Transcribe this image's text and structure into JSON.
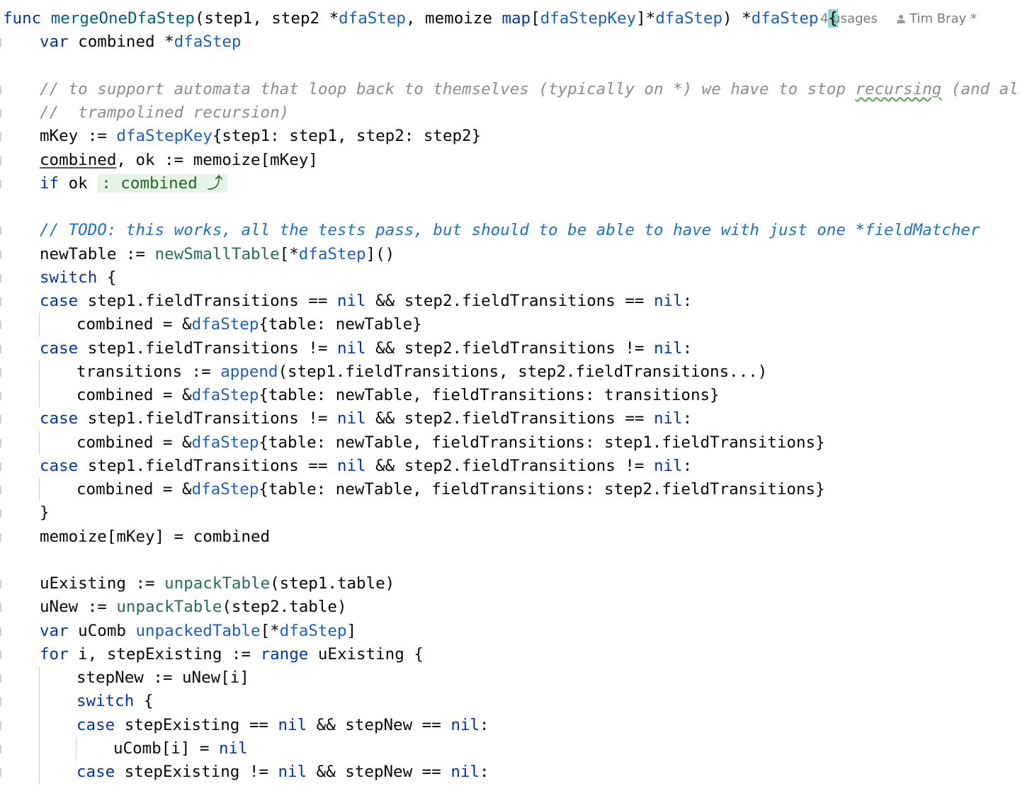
{
  "editor": {
    "inlay_usages": "4 usages",
    "inlay_author": "Tim Bray",
    "inlay_author_mark": "*",
    "lines": [
      {
        "indent": 0,
        "tokens": [
          {
            "t": "func ",
            "c": "kw"
          },
          {
            "t": "mergeOneDfaStep",
            "c": "func"
          },
          {
            "t": "(step1, step2 *",
            "c": "plain"
          },
          {
            "t": "dfaStep",
            "c": "type"
          },
          {
            "t": ", memoize ",
            "c": "plain"
          },
          {
            "t": "map",
            "c": "kw"
          },
          {
            "t": "[",
            "c": "plain"
          },
          {
            "t": "dfaStepKey",
            "c": "type"
          },
          {
            "t": "]*",
            "c": "plain"
          },
          {
            "t": "dfaStep",
            "c": "type"
          },
          {
            "t": ") *",
            "c": "plain"
          },
          {
            "t": "dfaStep",
            "c": "type"
          },
          {
            "t": " ",
            "c": "plain"
          },
          {
            "t": "{",
            "c": "brace-hl"
          }
        ]
      },
      {
        "indent": 1,
        "tokens": [
          {
            "t": "var",
            "c": "kw"
          },
          {
            "t": " combined *",
            "c": "plain"
          },
          {
            "t": "dfaStep",
            "c": "type"
          }
        ]
      },
      {
        "indent": 0,
        "tokens": []
      },
      {
        "indent": 1,
        "tokens": [
          {
            "t": "// to support automata that loop back to themselves (typically on *) we have to stop ",
            "c": "comment"
          },
          {
            "t": "recursing",
            "c": "comment-squiggle"
          },
          {
            "t": " (and also",
            "c": "comment"
          }
        ]
      },
      {
        "indent": 1,
        "tokens": [
          {
            "t": "//  trampolined recursion)",
            "c": "comment"
          }
        ]
      },
      {
        "indent": 1,
        "tokens": [
          {
            "t": "mKey := ",
            "c": "plain"
          },
          {
            "t": "dfaStepKey",
            "c": "type"
          },
          {
            "t": "{step1: step1, step2: step2}",
            "c": "plain"
          }
        ]
      },
      {
        "indent": 1,
        "tokens": [
          {
            "t": "combined",
            "c": "under"
          },
          {
            "t": ", ok := memoize[mKey]",
            "c": "plain"
          }
        ]
      },
      {
        "indent": 1,
        "tokens": [
          {
            "t": "if",
            "c": "kw"
          },
          {
            "t": " ok ",
            "c": "plain"
          },
          {
            "t": ": combined ⤴",
            "c": "hint"
          }
        ]
      },
      {
        "indent": 0,
        "tokens": []
      },
      {
        "indent": 1,
        "tokens": [
          {
            "t": "// TODO: this works, all the tests pass, but should to be able to have with just one *fieldMatcher",
            "c": "todo"
          }
        ]
      },
      {
        "indent": 1,
        "tokens": [
          {
            "t": "newTable := ",
            "c": "plain"
          },
          {
            "t": "newSmallTable",
            "c": "call"
          },
          {
            "t": "[*",
            "c": "plain"
          },
          {
            "t": "dfaStep",
            "c": "type"
          },
          {
            "t": "]()",
            "c": "plain"
          }
        ]
      },
      {
        "indent": 1,
        "tokens": [
          {
            "t": "switch",
            "c": "kw"
          },
          {
            "t": " {",
            "c": "plain"
          }
        ]
      },
      {
        "indent": 1,
        "tokens": [
          {
            "t": "case",
            "c": "kw"
          },
          {
            "t": " step1.fieldTransitions == ",
            "c": "plain"
          },
          {
            "t": "nil",
            "c": "kw"
          },
          {
            "t": " && step2.fieldTransitions == ",
            "c": "plain"
          },
          {
            "t": "nil",
            "c": "kw"
          },
          {
            "t": ":",
            "c": "plain"
          }
        ]
      },
      {
        "indent": 2,
        "tokens": [
          {
            "t": "combined = &",
            "c": "plain"
          },
          {
            "t": "dfaStep",
            "c": "type"
          },
          {
            "t": "{table: newTable}",
            "c": "plain"
          }
        ]
      },
      {
        "indent": 1,
        "tokens": [
          {
            "t": "case",
            "c": "kw"
          },
          {
            "t": " step1.fieldTransitions != ",
            "c": "plain"
          },
          {
            "t": "nil",
            "c": "kw"
          },
          {
            "t": " && step2.fieldTransitions != ",
            "c": "plain"
          },
          {
            "t": "nil",
            "c": "kw"
          },
          {
            "t": ":",
            "c": "plain"
          }
        ]
      },
      {
        "indent": 2,
        "tokens": [
          {
            "t": "transitions := ",
            "c": "plain"
          },
          {
            "t": "append",
            "c": "type"
          },
          {
            "t": "(step1.fieldTransitions, step2.fieldTransitions...)",
            "c": "plain"
          }
        ]
      },
      {
        "indent": 2,
        "tokens": [
          {
            "t": "combined = &",
            "c": "plain"
          },
          {
            "t": "dfaStep",
            "c": "type"
          },
          {
            "t": "{table: newTable, fieldTransitions: transitions}",
            "c": "plain"
          }
        ]
      },
      {
        "indent": 1,
        "tokens": [
          {
            "t": "case",
            "c": "kw"
          },
          {
            "t": " step1.fieldTransitions != ",
            "c": "plain"
          },
          {
            "t": "nil",
            "c": "kw"
          },
          {
            "t": " && step2.fieldTransitions == ",
            "c": "plain"
          },
          {
            "t": "nil",
            "c": "kw"
          },
          {
            "t": ":",
            "c": "plain"
          }
        ]
      },
      {
        "indent": 2,
        "tokens": [
          {
            "t": "combined = &",
            "c": "plain"
          },
          {
            "t": "dfaStep",
            "c": "type"
          },
          {
            "t": "{table: newTable, fieldTransitions: step1.fieldTransitions}",
            "c": "plain"
          }
        ]
      },
      {
        "indent": 1,
        "tokens": [
          {
            "t": "case",
            "c": "kw"
          },
          {
            "t": " step1.fieldTransitions == ",
            "c": "plain"
          },
          {
            "t": "nil",
            "c": "kw"
          },
          {
            "t": " && step2.fieldTransitions != ",
            "c": "plain"
          },
          {
            "t": "nil",
            "c": "kw"
          },
          {
            "t": ":",
            "c": "plain"
          }
        ]
      },
      {
        "indent": 2,
        "tokens": [
          {
            "t": "combined = &",
            "c": "plain"
          },
          {
            "t": "dfaStep",
            "c": "type"
          },
          {
            "t": "{table: newTable, fieldTransitions: step2.fieldTransitions}",
            "c": "plain"
          }
        ]
      },
      {
        "indent": 1,
        "tokens": [
          {
            "t": "}",
            "c": "plain"
          }
        ]
      },
      {
        "indent": 1,
        "tokens": [
          {
            "t": "memoize[mKey] = combined",
            "c": "plain"
          }
        ]
      },
      {
        "indent": 0,
        "tokens": []
      },
      {
        "indent": 1,
        "tokens": [
          {
            "t": "uExisting := ",
            "c": "plain"
          },
          {
            "t": "unpackTable",
            "c": "call"
          },
          {
            "t": "(step1.table)",
            "c": "plain"
          }
        ]
      },
      {
        "indent": 1,
        "tokens": [
          {
            "t": "uNew := ",
            "c": "plain"
          },
          {
            "t": "unpackTable",
            "c": "call"
          },
          {
            "t": "(step2.table)",
            "c": "plain"
          }
        ]
      },
      {
        "indent": 1,
        "tokens": [
          {
            "t": "var",
            "c": "kw"
          },
          {
            "t": " uComb ",
            "c": "plain"
          },
          {
            "t": "unpackedTable",
            "c": "type"
          },
          {
            "t": "[*",
            "c": "plain"
          },
          {
            "t": "dfaStep",
            "c": "type"
          },
          {
            "t": "]",
            "c": "plain"
          }
        ]
      },
      {
        "indent": 1,
        "tokens": [
          {
            "t": "for",
            "c": "kw"
          },
          {
            "t": " i, stepExisting := ",
            "c": "plain"
          },
          {
            "t": "range",
            "c": "kw"
          },
          {
            "t": " uExisting {",
            "c": "plain"
          }
        ]
      },
      {
        "indent": 2,
        "tokens": [
          {
            "t": "stepNew := uNew[i]",
            "c": "plain"
          }
        ]
      },
      {
        "indent": 2,
        "tokens": [
          {
            "t": "switch",
            "c": "kw"
          },
          {
            "t": " {",
            "c": "plain"
          }
        ]
      },
      {
        "indent": 2,
        "tokens": [
          {
            "t": "case",
            "c": "kw"
          },
          {
            "t": " stepExisting == ",
            "c": "plain"
          },
          {
            "t": "nil",
            "c": "kw"
          },
          {
            "t": " && stepNew == ",
            "c": "plain"
          },
          {
            "t": "nil",
            "c": "kw"
          },
          {
            "t": ":",
            "c": "plain"
          }
        ]
      },
      {
        "indent": 3,
        "tokens": [
          {
            "t": "uComb[i] = ",
            "c": "plain"
          },
          {
            "t": "nil",
            "c": "kw"
          }
        ]
      },
      {
        "indent": 2,
        "tokens": [
          {
            "t": "case",
            "c": "kw"
          },
          {
            "t": " stepExisting != ",
            "c": "plain"
          },
          {
            "t": "nil",
            "c": "kw"
          },
          {
            "t": " && stepNew == ",
            "c": "plain"
          },
          {
            "t": "nil",
            "c": "kw"
          },
          {
            "t": ":",
            "c": "plain"
          }
        ]
      }
    ]
  }
}
